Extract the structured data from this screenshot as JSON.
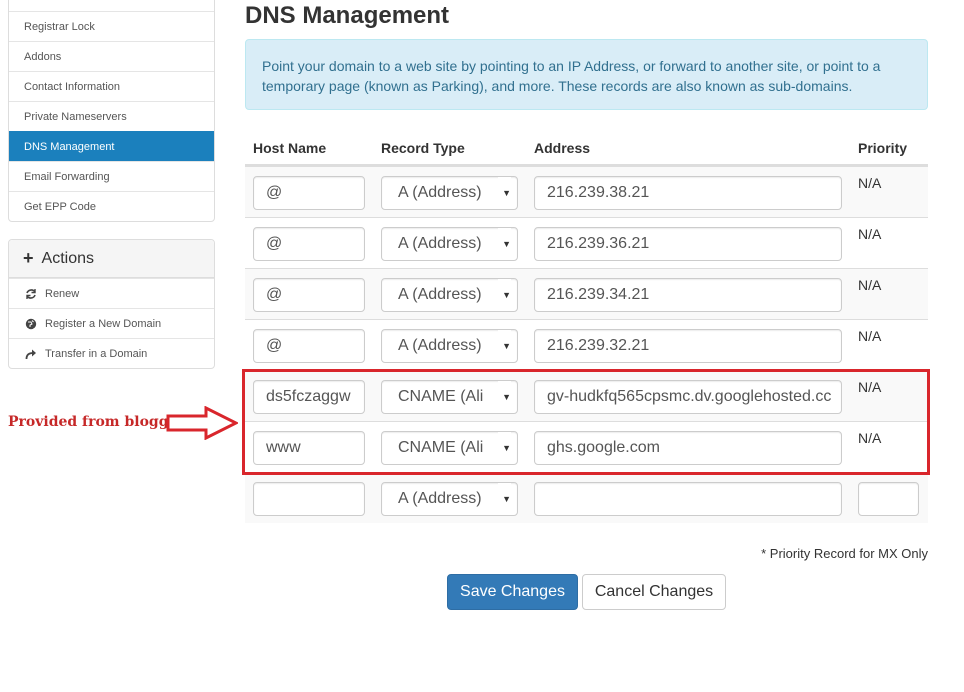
{
  "sidebar": {
    "items": [
      {
        "label": ""
      },
      {
        "label": "Registrar Lock"
      },
      {
        "label": "Addons"
      },
      {
        "label": "Contact Information"
      },
      {
        "label": "Private Nameservers"
      },
      {
        "label": "DNS Management"
      },
      {
        "label": "Email Forwarding"
      },
      {
        "label": "Get EPP Code"
      }
    ],
    "active_item": "DNS Management",
    "active_color": "#1b80bd"
  },
  "actions": {
    "title": "Actions",
    "items": [
      {
        "label": "Renew",
        "icon": "refresh-icon"
      },
      {
        "label": "Register a New Domain",
        "icon": "globe-icon"
      },
      {
        "label": "Transfer in a Domain",
        "icon": "share-arrow-icon"
      }
    ]
  },
  "main": {
    "title": "DNS Management",
    "info": "Point your domain to a web site by pointing to an IP Address, or forward to another site, or point to a temporary page (known as Parking), and more. These records are also known as sub-domains."
  },
  "table": {
    "headers": {
      "host": "Host Name",
      "type": "Record Type",
      "address": "Address",
      "priority": "Priority"
    },
    "rows": [
      {
        "host": "@",
        "type": "A (Address)",
        "address": "216.239.38.21",
        "priority": "N/A"
      },
      {
        "host": "@",
        "type": "A (Address)",
        "address": "216.239.36.21",
        "priority": "N/A"
      },
      {
        "host": "@",
        "type": "A (Address)",
        "address": "216.239.34.21",
        "priority": "N/A"
      },
      {
        "host": "@",
        "type": "A (Address)",
        "address": "216.239.32.21",
        "priority": "N/A"
      },
      {
        "host": "ds5fczaggw",
        "type": "CNAME (Ali",
        "address": "gv-hudkfq565cpsmc.dv.googlehosted.cc",
        "priority": "N/A"
      },
      {
        "host": "www",
        "type": "CNAME (Ali",
        "address": "ghs.google.com",
        "priority": "N/A"
      }
    ],
    "new_row": {
      "host": "",
      "type": "A (Address)",
      "address": "",
      "priority": ""
    }
  },
  "note": "* Priority Record for MX Only",
  "buttons": {
    "save": "Save Changes",
    "cancel": "Cancel Changes"
  },
  "annotation": {
    "label": "Provided from blogger",
    "color": "#d9262c"
  }
}
